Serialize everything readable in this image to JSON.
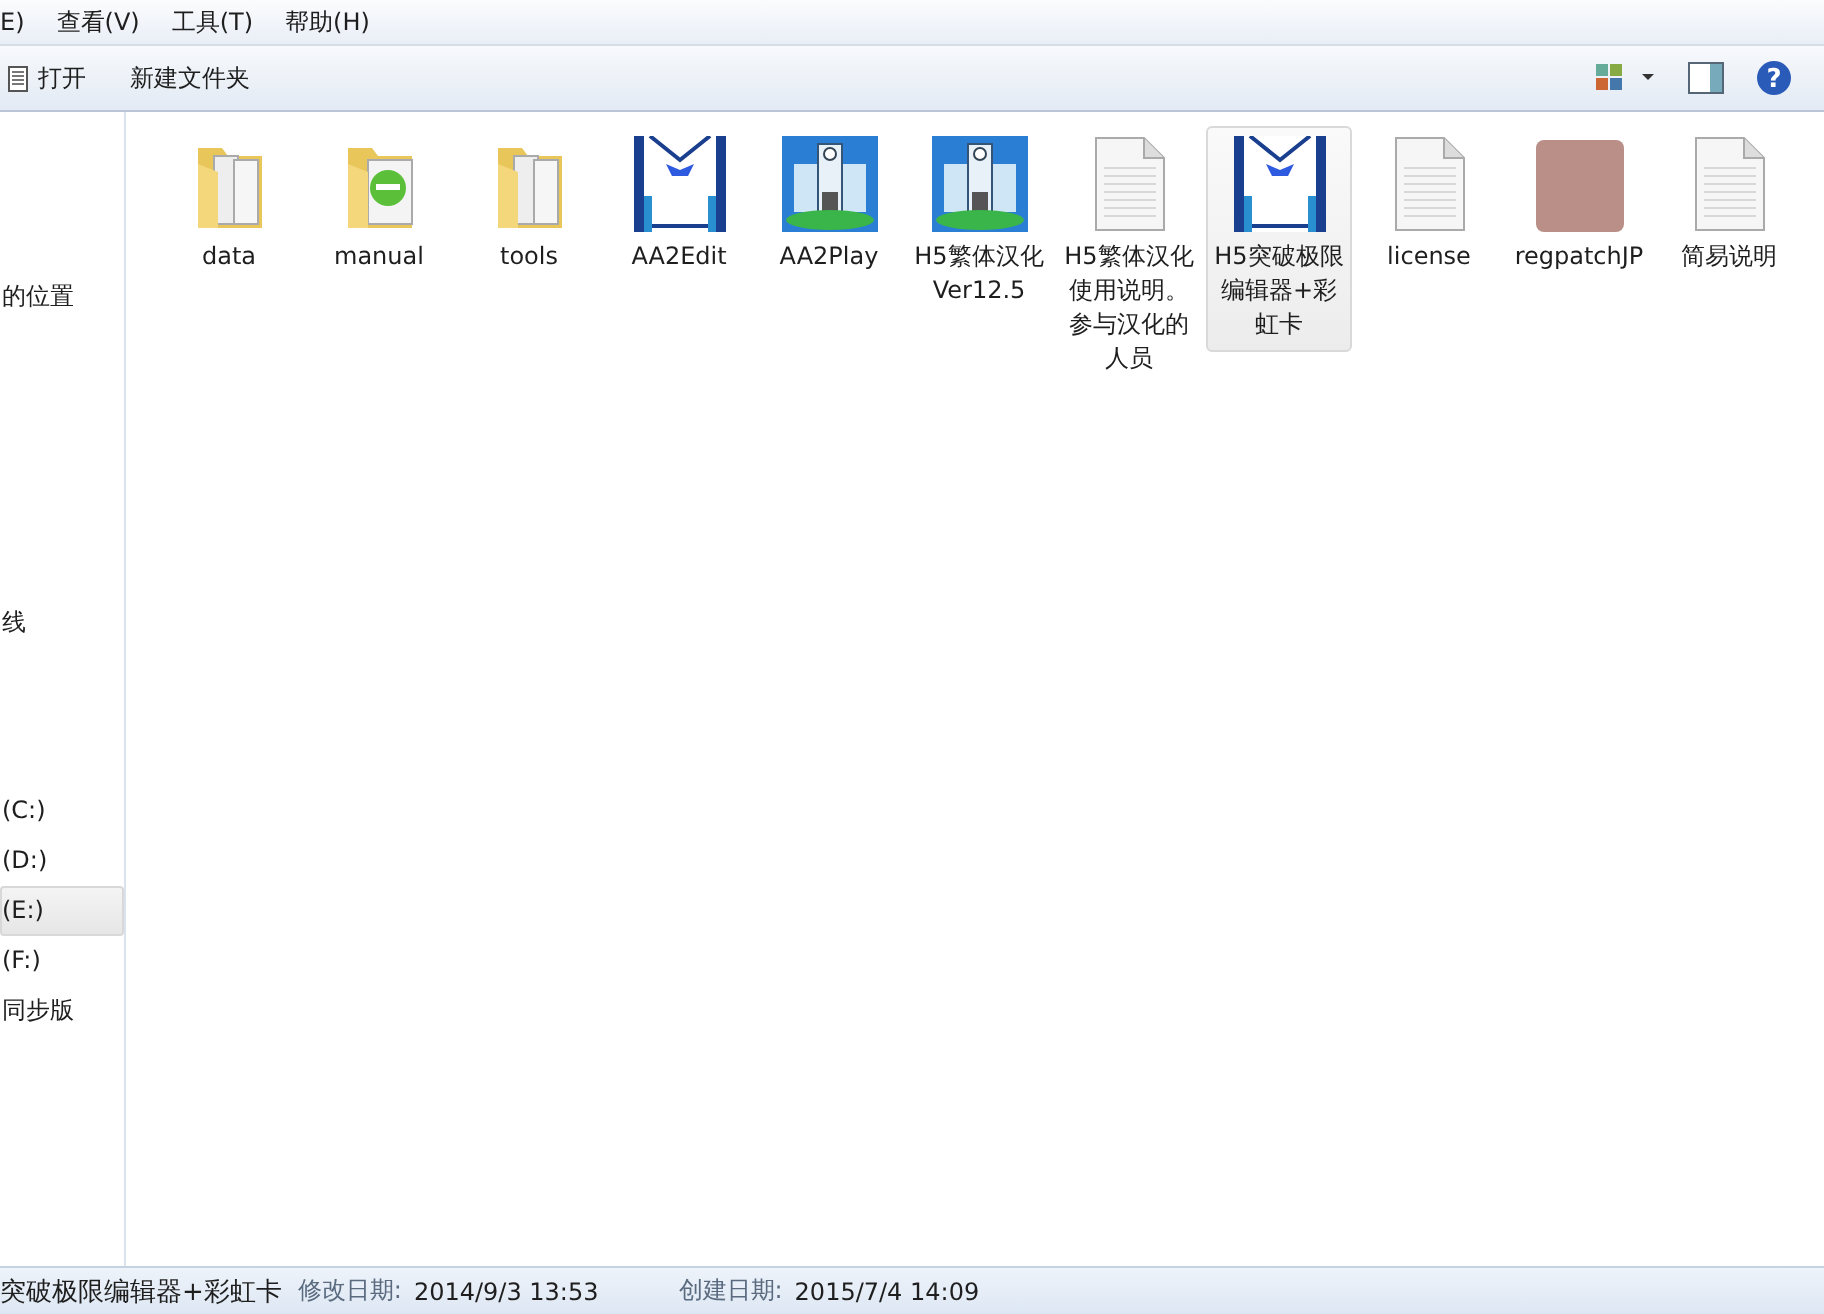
{
  "menu": [
    {
      "label": "E)"
    },
    {
      "label": "查看(V)"
    },
    {
      "label": "工具(T)"
    },
    {
      "label": "帮助(H)"
    }
  ],
  "toolbar": {
    "help_glyph": "?",
    "buttons": [
      {
        "label": "打开",
        "kind": "open"
      },
      {
        "label": "新建文件夹",
        "kind": "plain"
      }
    ]
  },
  "sidebar": {
    "items": [
      {
        "label": "的位置",
        "kind": "gap-before",
        "selected": false
      },
      {
        "label": "线",
        "kind": "gap-before",
        "selected": false
      },
      {
        "label": "(C:)",
        "kind": "drive",
        "selected": false
      },
      {
        "label": "(D:)",
        "kind": "drive",
        "selected": false
      },
      {
        "label": "(E:)",
        "kind": "drive",
        "selected": true
      },
      {
        "label": "(F:)",
        "kind": "drive",
        "selected": false
      },
      {
        "label": "同步版",
        "kind": "drive",
        "selected": false
      }
    ]
  },
  "files": [
    {
      "name": "data",
      "kind": "folder",
      "selected": false
    },
    {
      "name": "manual",
      "kind": "folder-e",
      "selected": false
    },
    {
      "name": "tools",
      "kind": "folder",
      "selected": false
    },
    {
      "name": "AA2Edit",
      "kind": "uniform",
      "selected": false
    },
    {
      "name": "AA2Play",
      "kind": "school",
      "selected": false
    },
    {
      "name": "H5繁体汉化Ver12.5",
      "kind": "school",
      "selected": false
    },
    {
      "name": "H5繁体汉化使用说明。参与汉化的人员",
      "kind": "document",
      "selected": false
    },
    {
      "name": "H5突破极限编辑器+彩虹卡",
      "kind": "uniform",
      "selected": true
    },
    {
      "name": "license",
      "kind": "document",
      "selected": false
    },
    {
      "name": "regpatchJP",
      "kind": "photo",
      "selected": false
    },
    {
      "name": "简易说明",
      "kind": "document",
      "selected": false
    }
  ],
  "status_bar": {
    "name": "突破极限编辑器+彩虹卡",
    "modified_label": "修改日期:",
    "modified": "2014/9/3 13:53",
    "created_label": "创建日期:",
    "created": "2015/7/4 14:09"
  }
}
